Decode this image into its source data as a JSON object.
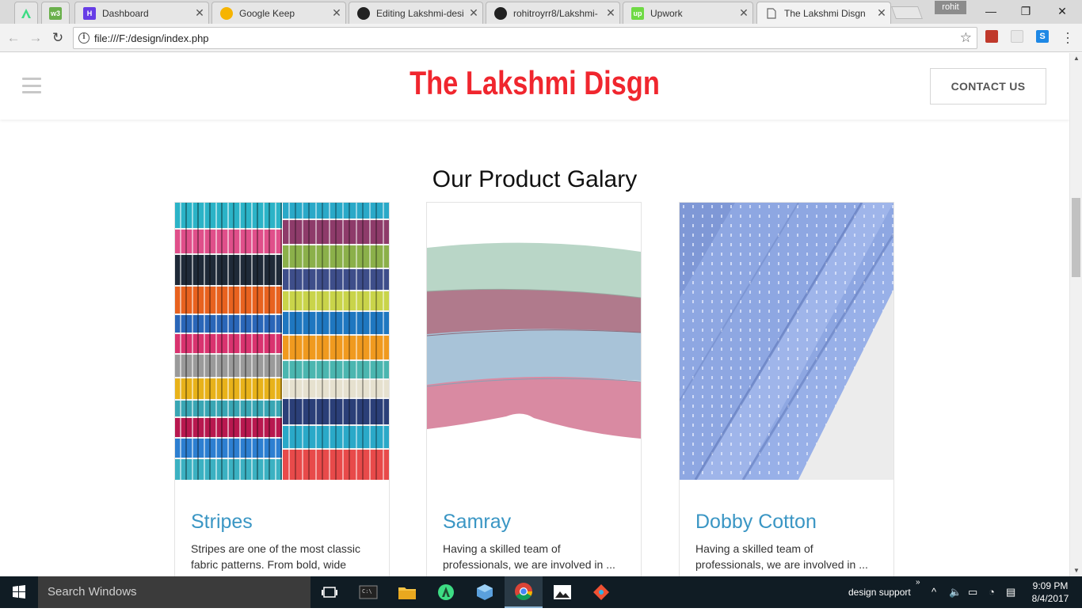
{
  "browser": {
    "tabs": [
      {
        "title": "",
        "pinned": true,
        "icon": "android-studio-icon",
        "icon_color": "#3ddc84"
      },
      {
        "title": "",
        "pinned": true,
        "icon": "w3schools-icon",
        "icon_color": "#6ab04c"
      },
      {
        "title": "Dashboard",
        "icon": "hostinger-icon",
        "icon_color": "#673de6"
      },
      {
        "title": "Google Keep",
        "icon": "google-keep-icon",
        "icon_color": "#f6b400"
      },
      {
        "title": "Editing Lakshmi-desi",
        "icon": "github-icon",
        "icon_color": "#222222"
      },
      {
        "title": "rohitroyrr8/Lakshmi-",
        "icon": "github-icon",
        "icon_color": "#222222"
      },
      {
        "title": "Upwork",
        "icon": "upwork-icon",
        "icon_color": "#6fda44"
      },
      {
        "title": "The Lakshmi Disgn",
        "icon": "page-icon",
        "icon_color": "#777777",
        "active": true
      }
    ],
    "profile_name": "rohit",
    "url": "file:///F:/design/index.php"
  },
  "site": {
    "brand": "The Lakshmi Disgn",
    "brand_color": "#f0262e",
    "contact_label": "CONTACT US",
    "gallery_title": "Our Product Galary",
    "accent_color": "#3a96c4",
    "products": [
      {
        "name": "Stripes",
        "description": "Stripes are one of the most classic fabric patterns. From bold, wide stripes to thin ones, we ..."
      },
      {
        "name": "Samray",
        "description": "Having a skilled team of professionals, we are involved in ..."
      },
      {
        "name": "Dobby Cotton",
        "description": "Having a skilled team of professionals, we are involved in ..."
      }
    ]
  },
  "taskbar": {
    "search_placeholder": "Search Windows",
    "tray_label": "design support",
    "time": "9:09 PM",
    "date": "8/4/2017"
  }
}
